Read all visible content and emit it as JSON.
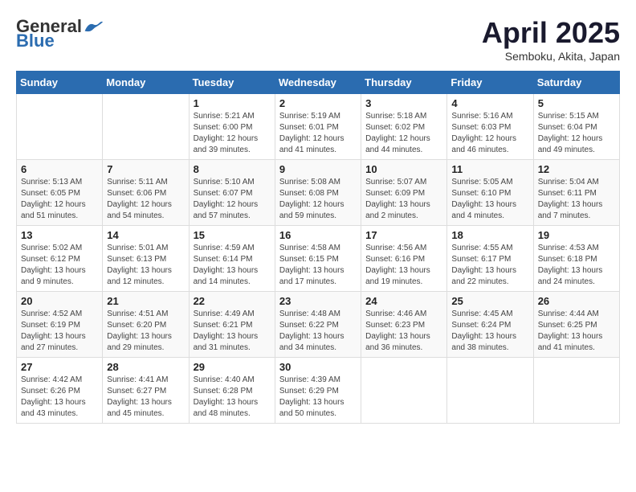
{
  "header": {
    "logo_general": "General",
    "logo_blue": "Blue",
    "month_title": "April 2025",
    "location": "Semboku, Akita, Japan"
  },
  "weekdays": [
    "Sunday",
    "Monday",
    "Tuesday",
    "Wednesday",
    "Thursday",
    "Friday",
    "Saturday"
  ],
  "weeks": [
    [
      {
        "day": "",
        "info": ""
      },
      {
        "day": "",
        "info": ""
      },
      {
        "day": "1",
        "info": "Sunrise: 5:21 AM\nSunset: 6:00 PM\nDaylight: 12 hours and 39 minutes."
      },
      {
        "day": "2",
        "info": "Sunrise: 5:19 AM\nSunset: 6:01 PM\nDaylight: 12 hours and 41 minutes."
      },
      {
        "day": "3",
        "info": "Sunrise: 5:18 AM\nSunset: 6:02 PM\nDaylight: 12 hours and 44 minutes."
      },
      {
        "day": "4",
        "info": "Sunrise: 5:16 AM\nSunset: 6:03 PM\nDaylight: 12 hours and 46 minutes."
      },
      {
        "day": "5",
        "info": "Sunrise: 5:15 AM\nSunset: 6:04 PM\nDaylight: 12 hours and 49 minutes."
      }
    ],
    [
      {
        "day": "6",
        "info": "Sunrise: 5:13 AM\nSunset: 6:05 PM\nDaylight: 12 hours and 51 minutes."
      },
      {
        "day": "7",
        "info": "Sunrise: 5:11 AM\nSunset: 6:06 PM\nDaylight: 12 hours and 54 minutes."
      },
      {
        "day": "8",
        "info": "Sunrise: 5:10 AM\nSunset: 6:07 PM\nDaylight: 12 hours and 57 minutes."
      },
      {
        "day": "9",
        "info": "Sunrise: 5:08 AM\nSunset: 6:08 PM\nDaylight: 12 hours and 59 minutes."
      },
      {
        "day": "10",
        "info": "Sunrise: 5:07 AM\nSunset: 6:09 PM\nDaylight: 13 hours and 2 minutes."
      },
      {
        "day": "11",
        "info": "Sunrise: 5:05 AM\nSunset: 6:10 PM\nDaylight: 13 hours and 4 minutes."
      },
      {
        "day": "12",
        "info": "Sunrise: 5:04 AM\nSunset: 6:11 PM\nDaylight: 13 hours and 7 minutes."
      }
    ],
    [
      {
        "day": "13",
        "info": "Sunrise: 5:02 AM\nSunset: 6:12 PM\nDaylight: 13 hours and 9 minutes."
      },
      {
        "day": "14",
        "info": "Sunrise: 5:01 AM\nSunset: 6:13 PM\nDaylight: 13 hours and 12 minutes."
      },
      {
        "day": "15",
        "info": "Sunrise: 4:59 AM\nSunset: 6:14 PM\nDaylight: 13 hours and 14 minutes."
      },
      {
        "day": "16",
        "info": "Sunrise: 4:58 AM\nSunset: 6:15 PM\nDaylight: 13 hours and 17 minutes."
      },
      {
        "day": "17",
        "info": "Sunrise: 4:56 AM\nSunset: 6:16 PM\nDaylight: 13 hours and 19 minutes."
      },
      {
        "day": "18",
        "info": "Sunrise: 4:55 AM\nSunset: 6:17 PM\nDaylight: 13 hours and 22 minutes."
      },
      {
        "day": "19",
        "info": "Sunrise: 4:53 AM\nSunset: 6:18 PM\nDaylight: 13 hours and 24 minutes."
      }
    ],
    [
      {
        "day": "20",
        "info": "Sunrise: 4:52 AM\nSunset: 6:19 PM\nDaylight: 13 hours and 27 minutes."
      },
      {
        "day": "21",
        "info": "Sunrise: 4:51 AM\nSunset: 6:20 PM\nDaylight: 13 hours and 29 minutes."
      },
      {
        "day": "22",
        "info": "Sunrise: 4:49 AM\nSunset: 6:21 PM\nDaylight: 13 hours and 31 minutes."
      },
      {
        "day": "23",
        "info": "Sunrise: 4:48 AM\nSunset: 6:22 PM\nDaylight: 13 hours and 34 minutes."
      },
      {
        "day": "24",
        "info": "Sunrise: 4:46 AM\nSunset: 6:23 PM\nDaylight: 13 hours and 36 minutes."
      },
      {
        "day": "25",
        "info": "Sunrise: 4:45 AM\nSunset: 6:24 PM\nDaylight: 13 hours and 38 minutes."
      },
      {
        "day": "26",
        "info": "Sunrise: 4:44 AM\nSunset: 6:25 PM\nDaylight: 13 hours and 41 minutes."
      }
    ],
    [
      {
        "day": "27",
        "info": "Sunrise: 4:42 AM\nSunset: 6:26 PM\nDaylight: 13 hours and 43 minutes."
      },
      {
        "day": "28",
        "info": "Sunrise: 4:41 AM\nSunset: 6:27 PM\nDaylight: 13 hours and 45 minutes."
      },
      {
        "day": "29",
        "info": "Sunrise: 4:40 AM\nSunset: 6:28 PM\nDaylight: 13 hours and 48 minutes."
      },
      {
        "day": "30",
        "info": "Sunrise: 4:39 AM\nSunset: 6:29 PM\nDaylight: 13 hours and 50 minutes."
      },
      {
        "day": "",
        "info": ""
      },
      {
        "day": "",
        "info": ""
      },
      {
        "day": "",
        "info": ""
      }
    ]
  ]
}
